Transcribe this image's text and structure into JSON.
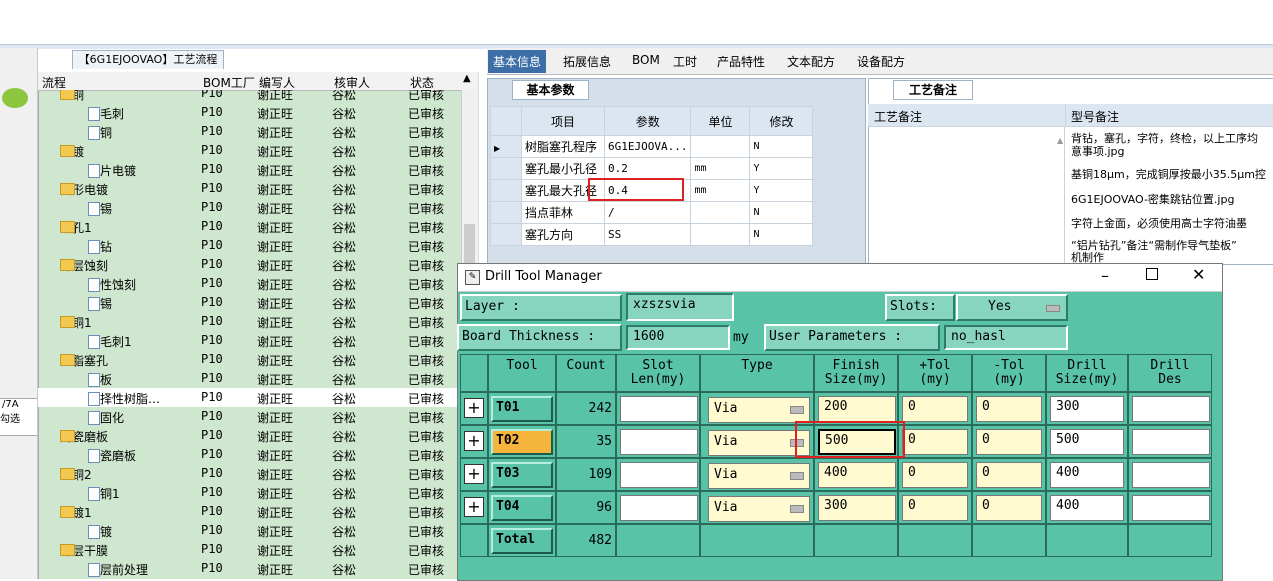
{
  "workflow": {
    "tab_title": "【6G1EJOOVAO】工艺流程",
    "headers": [
      "流程",
      "BOM工厂",
      "编写人",
      "核审人",
      "状态"
    ],
    "left_partial": [
      "/7A",
      "勾选"
    ],
    "rows": [
      {
        "level": 1,
        "type": "folder",
        "name": "沉铜",
        "bom": "P10",
        "author": "谢正旺",
        "reviewer": "谷松",
        "status": "已审核"
      },
      {
        "level": 2,
        "type": "doc",
        "name": "去毛刺",
        "bom": "P10",
        "author": "谢正旺",
        "reviewer": "谷松",
        "status": "已审核"
      },
      {
        "level": 2,
        "type": "doc",
        "name": "沉铜",
        "bom": "P10",
        "author": "谢正旺",
        "reviewer": "谷松",
        "status": "已审核"
      },
      {
        "level": 1,
        "type": "folder",
        "name": "电镀",
        "bom": "P10",
        "author": "谢正旺",
        "reviewer": "谷松",
        "status": "已审核"
      },
      {
        "level": 2,
        "type": "doc",
        "name": "负片电镀",
        "bom": "P10",
        "author": "谢正旺",
        "reviewer": "谷松",
        "status": "已审核"
      },
      {
        "level": 1,
        "type": "folder",
        "name": "图形电镀",
        "bom": "P10",
        "author": "谢正旺",
        "reviewer": "谷松",
        "status": "已审核"
      },
      {
        "level": 2,
        "type": "doc",
        "name": "镀锡",
        "bom": "P10",
        "author": "谢正旺",
        "reviewer": "谷松",
        "status": "已审核"
      },
      {
        "level": 1,
        "type": "folder",
        "name": "钻孔1",
        "bom": "P10",
        "author": "谢正旺",
        "reviewer": "谷松",
        "status": "已审核"
      },
      {
        "level": 2,
        "type": "doc",
        "name": "背钻",
        "bom": "P10",
        "author": "谢正旺",
        "reviewer": "谷松",
        "status": "已审核"
      },
      {
        "level": 1,
        "type": "folder",
        "name": "外层蚀刻",
        "bom": "P10",
        "author": "谢正旺",
        "reviewer": "谷松",
        "status": "已审核"
      },
      {
        "level": 2,
        "type": "doc",
        "name": "碱性蚀刻",
        "bom": "P10",
        "author": "谢正旺",
        "reviewer": "谷松",
        "status": "已审核"
      },
      {
        "level": 2,
        "type": "doc",
        "name": "退锡",
        "bom": "P10",
        "author": "谢正旺",
        "reviewer": "谷松",
        "status": "已审核"
      },
      {
        "level": 1,
        "type": "folder",
        "name": "沉铜1",
        "bom": "P10",
        "author": "谢正旺",
        "reviewer": "谷松",
        "status": "已审核"
      },
      {
        "level": 2,
        "type": "doc",
        "name": "去毛刺1",
        "bom": "P10",
        "author": "谢正旺",
        "reviewer": "谷松",
        "status": "已审核"
      },
      {
        "level": 1,
        "type": "folder",
        "name": "树脂塞孔",
        "bom": "P10",
        "author": "谢正旺",
        "reviewer": "谷松",
        "status": "已审核"
      },
      {
        "level": 2,
        "type": "doc",
        "name": "烘板",
        "bom": "P10",
        "author": "谢正旺",
        "reviewer": "谷松",
        "status": "已审核"
      },
      {
        "level": 2,
        "type": "doc",
        "name": "选择性树脂…",
        "bom": "P10",
        "author": "谢正旺",
        "reviewer": "谷松",
        "status": "已审核",
        "selected": true
      },
      {
        "level": 2,
        "type": "doc",
        "name": "终固化",
        "bom": "P10",
        "author": "谢正旺",
        "reviewer": "谷松",
        "status": "已审核"
      },
      {
        "level": 1,
        "type": "folder",
        "name": "陶瓷磨板",
        "bom": "P10",
        "author": "谢正旺",
        "reviewer": "谷松",
        "status": "已审核"
      },
      {
        "level": 2,
        "type": "doc",
        "name": "陶瓷磨板",
        "bom": "P10",
        "author": "谢正旺",
        "reviewer": "谷松",
        "status": "已审核"
      },
      {
        "level": 1,
        "type": "folder",
        "name": "沉铜2",
        "bom": "P10",
        "author": "谢正旺",
        "reviewer": "谷松",
        "status": "已审核"
      },
      {
        "level": 2,
        "type": "doc",
        "name": "沉铜1",
        "bom": "P10",
        "author": "谢正旺",
        "reviewer": "谷松",
        "status": "已审核"
      },
      {
        "level": 1,
        "type": "folder",
        "name": "电镀1",
        "bom": "P10",
        "author": "谢正旺",
        "reviewer": "谷松",
        "status": "已审核"
      },
      {
        "level": 2,
        "type": "doc",
        "name": "板镀",
        "bom": "P10",
        "author": "谢正旺",
        "reviewer": "谷松",
        "status": "已审核"
      },
      {
        "level": 1,
        "type": "folder",
        "name": "外层干膜",
        "bom": "P10",
        "author": "谢正旺",
        "reviewer": "谷松",
        "status": "已审核"
      },
      {
        "level": 2,
        "type": "doc",
        "name": "外层前处理",
        "bom": "P10",
        "author": "谢正旺",
        "reviewer": "谷松",
        "status": "已审核"
      }
    ]
  },
  "tabs": [
    "基本信息",
    "拓展信息",
    "BOM",
    "工时",
    "产品特性",
    "文本配方",
    "设备配方"
  ],
  "params": {
    "tab": "基本参数",
    "headers": [
      "项目",
      "参数",
      "单位",
      "修改"
    ],
    "rows": [
      {
        "item": "树脂塞孔程序",
        "value": "6G1EJOOVA...",
        "unit": "",
        "edit": "N",
        "current": true
      },
      {
        "item": "塞孔最小孔径",
        "value": "0.2",
        "unit": "mm",
        "edit": "Y"
      },
      {
        "item": "塞孔最大孔径",
        "value": "0.4",
        "unit": "mm",
        "edit": "Y"
      },
      {
        "item": "挡点菲林",
        "value": "/",
        "unit": "",
        "edit": "N"
      },
      {
        "item": "塞孔方向",
        "value": "SS",
        "unit": "",
        "edit": "N"
      }
    ]
  },
  "notes": {
    "tab": "工艺备注",
    "col1": "工艺备注",
    "col2": "型号备注",
    "lines": [
      "背钻，塞孔，字符，终检，以上工序均",
      "意事项.jpg",
      "基铜18μm，完成铜厚按最小35.5μm控",
      "6G1EJOOVAO-密集跳钻位置.jpg",
      "字符上金面，必须使用高士字符油墨",
      "“铝片钻孔”备注“需制作导气垫板”",
      "机制作"
    ]
  },
  "dialog": {
    "title": "Drill Tool Manager",
    "layer_label": "Layer        :",
    "layer_value": "xzszsvia",
    "slots_label": "Slots:",
    "slots_value": "Yes",
    "thickness_label": "Board Thickness :",
    "thickness_value": "1600",
    "thickness_unit": "my",
    "user_params_label": "User Parameters :",
    "user_params_value": "no_hasl",
    "columns": [
      "Tool",
      "Count",
      "Slot\nLen(my)",
      "Type",
      "Finish\nSize(my)",
      "+Tol\n(my)",
      "-Tol\n(my)",
      "Drill\nSize(my)",
      "Drill\nDes"
    ],
    "tools": [
      {
        "name": "T01",
        "count": "242",
        "slot": "",
        "type": "Via",
        "finish": "200",
        "ptol": "0",
        "ntol": "0",
        "drill": "300",
        "des": ""
      },
      {
        "name": "T02",
        "count": "35",
        "slot": "",
        "type": "Via",
        "finish": "500",
        "ptol": "0",
        "ntol": "0",
        "drill": "500",
        "des": "",
        "active": true
      },
      {
        "name": "T03",
        "count": "109",
        "slot": "",
        "type": "Via",
        "finish": "400",
        "ptol": "0",
        "ntol": "0",
        "drill": "400",
        "des": ""
      },
      {
        "name": "T04",
        "count": "96",
        "slot": "",
        "type": "Via",
        "finish": "300",
        "ptol": "0",
        "ntol": "0",
        "drill": "400",
        "des": ""
      }
    ],
    "total_label": "Total",
    "total_count": "482"
  },
  "colors": {
    "accent": "#3d6ea7",
    "tree_bg": "#cfe6cf",
    "dialog_bg": "#59c3a8",
    "highlight": "#e02020",
    "active_tool": "#f5b43c"
  }
}
